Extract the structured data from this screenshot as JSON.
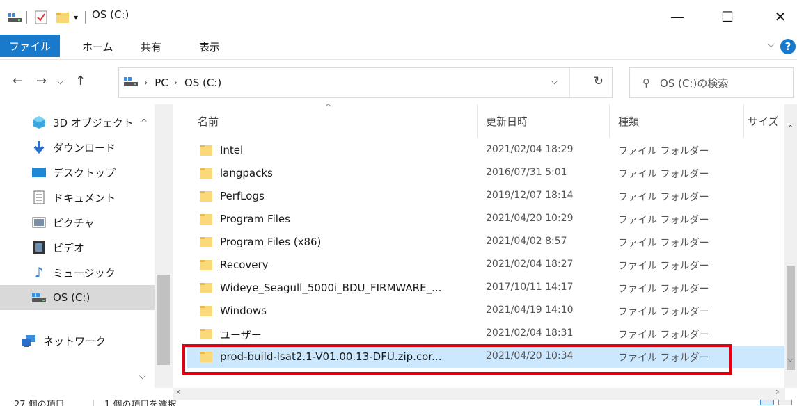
{
  "window": {
    "title": "OS (C:)",
    "controls": {
      "minimize": "—",
      "maximize": "☐",
      "close": "✕"
    }
  },
  "ribbon": {
    "tabs": [
      "ファイル",
      "ホーム",
      "共有",
      "表示"
    ],
    "help": "?",
    "expand": "⌵"
  },
  "address": {
    "crumbs": [
      "PC",
      "OS (C:)"
    ],
    "search_placeholder": "OS (C:)の検索"
  },
  "nav": {
    "items": [
      {
        "label": "3D オブジェクト",
        "icon": "3d-objects-icon"
      },
      {
        "label": "ダウンロード",
        "icon": "download-icon"
      },
      {
        "label": "デスクトップ",
        "icon": "desktop-icon"
      },
      {
        "label": "ドキュメント",
        "icon": "documents-icon"
      },
      {
        "label": "ピクチャ",
        "icon": "pictures-icon"
      },
      {
        "label": "ビデオ",
        "icon": "videos-icon"
      },
      {
        "label": "ミュージック",
        "icon": "music-icon"
      },
      {
        "label": "OS (C:)",
        "icon": "drive-icon",
        "selected": true
      },
      {
        "label": "ネットワーク",
        "icon": "network-icon"
      }
    ]
  },
  "columns": {
    "name": "名前",
    "date": "更新日時",
    "type": "種類",
    "size": "サイズ"
  },
  "files": [
    {
      "name": "Intel",
      "date": "2021/02/04 18:29",
      "type": "ファイル フォルダー"
    },
    {
      "name": "langpacks",
      "date": "2016/07/31 5:01",
      "type": "ファイル フォルダー"
    },
    {
      "name": "PerfLogs",
      "date": "2019/12/07 18:14",
      "type": "ファイル フォルダー"
    },
    {
      "name": "Program Files",
      "date": "2021/04/20 10:29",
      "type": "ファイル フォルダー"
    },
    {
      "name": "Program Files (x86)",
      "date": "2021/04/02 8:57",
      "type": "ファイル フォルダー"
    },
    {
      "name": "Recovery",
      "date": "2021/02/04 18:27",
      "type": "ファイル フォルダー"
    },
    {
      "name": "Wideye_Seagull_5000i_BDU_FIRMWARE_...",
      "date": "2017/10/11 14:17",
      "type": "ファイル フォルダー"
    },
    {
      "name": "Windows",
      "date": "2021/04/19 14:10",
      "type": "ファイル フォルダー"
    },
    {
      "name": "ユーザー",
      "date": "2021/02/04 18:31",
      "type": "ファイル フォルダー"
    },
    {
      "name": "prod-build-lsat2.1-V01.00.13-DFU.zip.cor...",
      "date": "2021/04/20 10:34",
      "type": "ファイル フォルダー",
      "selected": true
    }
  ],
  "status": {
    "count": "27 個の項目",
    "selection": "1 個の項目を選択"
  },
  "colors": {
    "accent": "#1979ca",
    "selection": "#cce8ff",
    "highlight": "#e00012",
    "folder": "#f8d775"
  }
}
